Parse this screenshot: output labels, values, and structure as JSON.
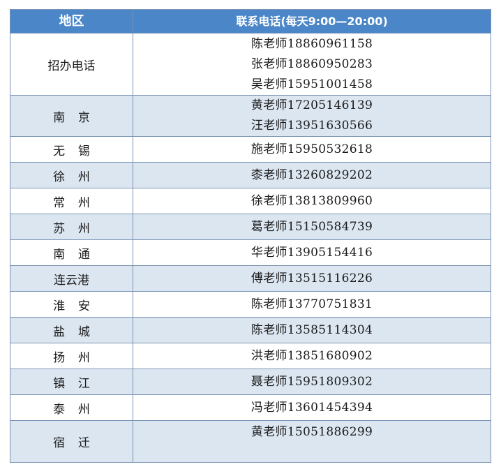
{
  "table": {
    "headers": {
      "region": "地区",
      "phone": "联系电话(每天9:00—20:00)"
    },
    "rows": [
      {
        "region": "招办电话",
        "spaced": false,
        "alt": false,
        "kind": "main",
        "phones": [
          "陈老师18860961158",
          "张老师18860950283",
          "吴老师15951001458"
        ]
      },
      {
        "region": "南京",
        "spaced": true,
        "alt": true,
        "kind": "double",
        "phones": [
          "黄老师17205146139",
          "汪老师13951630566"
        ]
      },
      {
        "region": "无锡",
        "spaced": true,
        "alt": false,
        "kind": "single",
        "phones": [
          "施老师15950532618"
        ]
      },
      {
        "region": "徐州",
        "spaced": true,
        "alt": true,
        "kind": "single",
        "phones": [
          "桼老师13260829202"
        ]
      },
      {
        "region": "常州",
        "spaced": true,
        "alt": false,
        "kind": "single",
        "phones": [
          "徐老师13813809960"
        ]
      },
      {
        "region": "苏州",
        "spaced": true,
        "alt": true,
        "kind": "single",
        "phones": [
          "葛老师15150584739"
        ]
      },
      {
        "region": "南通",
        "spaced": true,
        "alt": false,
        "kind": "single",
        "phones": [
          "华老师13905154416"
        ]
      },
      {
        "region": "连云港",
        "spaced": false,
        "alt": true,
        "kind": "single",
        "phones": [
          "傅老师13515116226"
        ]
      },
      {
        "region": "淮安",
        "spaced": true,
        "alt": false,
        "kind": "single",
        "phones": [
          "陈老师13770751831"
        ]
      },
      {
        "region": "盐城",
        "spaced": true,
        "alt": true,
        "kind": "single",
        "phones": [
          "陈老师13585114304"
        ]
      },
      {
        "region": "扬州",
        "spaced": true,
        "alt": false,
        "kind": "single",
        "phones": [
          "洪老师13851680902"
        ]
      },
      {
        "region": "镇江",
        "spaced": true,
        "alt": true,
        "kind": "single",
        "phones": [
          "聂老师15951809302"
        ]
      },
      {
        "region": "泰州",
        "spaced": true,
        "alt": false,
        "kind": "single",
        "phones": [
          "冯老师13601454394"
        ]
      },
      {
        "region": "宿迁",
        "spaced": true,
        "alt": true,
        "kind": "last",
        "phones": [
          "黄老师15051886299"
        ]
      }
    ]
  },
  "colors": {
    "header_bg": "#4a86c8",
    "header_text": "#ffffff",
    "alt_row_bg": "#dce6f1",
    "border": "#7a93b4"
  }
}
